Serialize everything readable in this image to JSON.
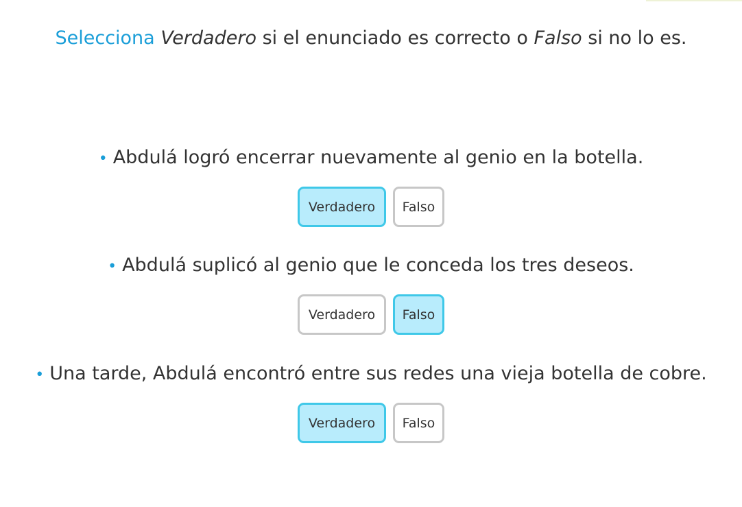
{
  "instruction": {
    "lead": "Selecciona",
    "term_true": "Verdadero",
    "middle": "si el enunciado es correcto o",
    "term_false": "Falso",
    "tail": "si no lo es."
  },
  "questions": [
    {
      "bullet": "•",
      "text": "Abdulá logró encerrar nuevamente al genio en la botella.",
      "options": [
        "Verdadero",
        "Falso"
      ],
      "selected": "Verdadero"
    },
    {
      "bullet": "•",
      "text": "Abdulá suplicó al genio que le conceda los tres deseos.",
      "options": [
        "Verdadero",
        "Falso"
      ],
      "selected": "Falso"
    },
    {
      "bullet": "•",
      "text": "Una tarde, Abdulá encontró entre sus redes una vieja botella de cobre.",
      "options": [
        "Verdadero",
        "Falso"
      ],
      "selected": "Verdadero"
    }
  ],
  "colors": {
    "accent": "#1a9ed8",
    "selected_fill": "#b8ecfc",
    "selected_border": "#3fc8e8",
    "unselected_border": "#c7c7c7"
  }
}
